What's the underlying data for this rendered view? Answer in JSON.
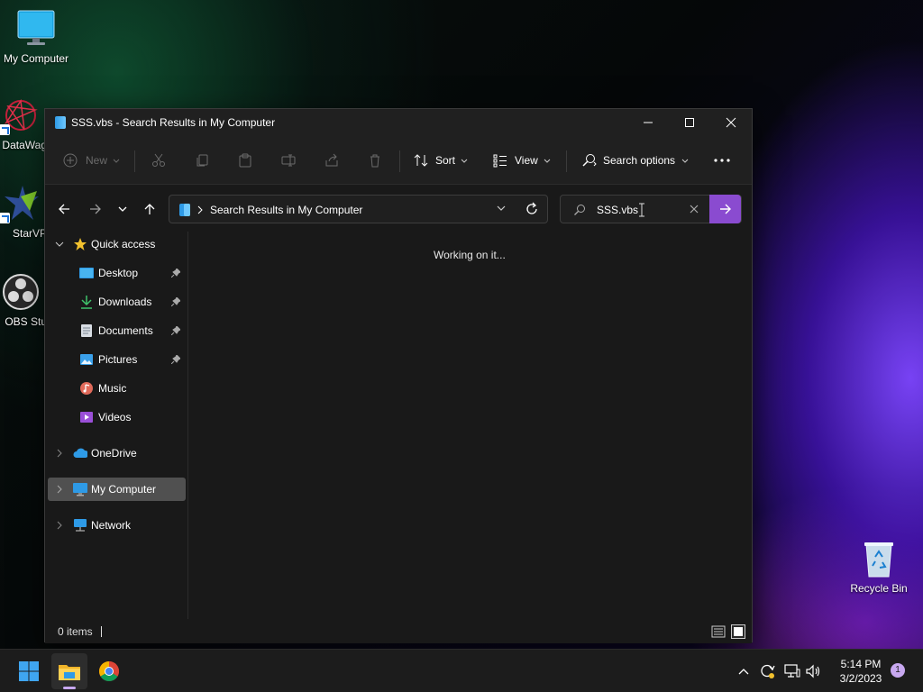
{
  "desktop": {
    "icons": [
      {
        "label": "My Computer"
      },
      {
        "label": "DataWag"
      },
      {
        "label": "StarVP"
      },
      {
        "label": "OBS Stu"
      },
      {
        "label": "Recycle Bin"
      }
    ]
  },
  "window": {
    "title": "SSS.vbs - Search Results in My Computer",
    "toolbar": {
      "new_label": "New",
      "sort_label": "Sort",
      "view_label": "View",
      "search_options_label": "Search options"
    },
    "address": {
      "path": "Search Results in My Computer"
    },
    "search": {
      "value": "SSS.vbs"
    },
    "sidebar": {
      "items": [
        {
          "label": "Quick access"
        },
        {
          "label": "Desktop"
        },
        {
          "label": "Downloads"
        },
        {
          "label": "Documents"
        },
        {
          "label": "Pictures"
        },
        {
          "label": "Music"
        },
        {
          "label": "Videos"
        },
        {
          "label": "OneDrive"
        },
        {
          "label": "My Computer"
        },
        {
          "label": "Network"
        }
      ]
    },
    "content": {
      "status_message": "Working on it..."
    },
    "statusbar": {
      "item_count": "0 items"
    }
  },
  "taskbar": {
    "clock_time": "5:14 PM",
    "clock_date": "3/2/2023",
    "notification_count": "1"
  },
  "colors": {
    "accent": "#8a4bd0",
    "folder_blue": "#2e9ae6",
    "quick_access_star": "#f2c12e"
  }
}
